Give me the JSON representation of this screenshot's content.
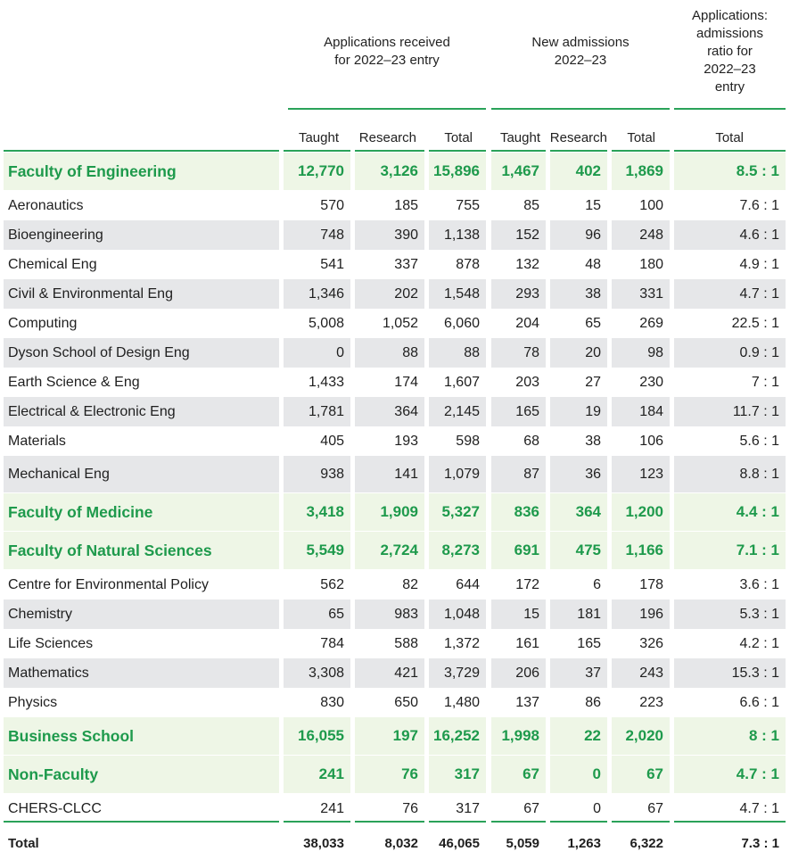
{
  "header": {
    "group_applications": "Applications received\nfor 2022–23 entry",
    "group_admissions": "New admissions\n2022–23",
    "group_ratio": "Applications:\nadmissions\nratio for\n2022–23\nentry",
    "col_taught": "Taught",
    "col_research": "Research",
    "col_total": "Total"
  },
  "rows": [
    {
      "name": "Faculty of Engineering",
      "type": "faculty",
      "a_t": "12,770",
      "a_r": "3,126",
      "a_tot": "15,896",
      "n_t": "1,467",
      "n_r": "402",
      "n_tot": "1,869",
      "ratio": "8.5 : 1"
    },
    {
      "name": "Aeronautics",
      "type": "white",
      "a_t": "570",
      "a_r": "185",
      "a_tot": "755",
      "n_t": "85",
      "n_r": "15",
      "n_tot": "100",
      "ratio": "7.6 : 1"
    },
    {
      "name": "Bioengineering",
      "type": "gray",
      "a_t": "748",
      "a_r": "390",
      "a_tot": "1,138",
      "n_t": "152",
      "n_r": "96",
      "n_tot": "248",
      "ratio": "4.6 : 1"
    },
    {
      "name": "Chemical Eng",
      "type": "white",
      "a_t": "541",
      "a_r": "337",
      "a_tot": "878",
      "n_t": "132",
      "n_r": "48",
      "n_tot": "180",
      "ratio": "4.9 : 1"
    },
    {
      "name": "Civil & Environmental Eng",
      "type": "gray",
      "a_t": "1,346",
      "a_r": "202",
      "a_tot": "1,548",
      "n_t": "293",
      "n_r": "38",
      "n_tot": "331",
      "ratio": "4.7 : 1"
    },
    {
      "name": "Computing",
      "type": "white",
      "a_t": "5,008",
      "a_r": "1,052",
      "a_tot": "6,060",
      "n_t": "204",
      "n_r": "65",
      "n_tot": "269",
      "ratio": "22.5 : 1"
    },
    {
      "name": "Dyson School of Design Eng",
      "type": "gray",
      "a_t": "0",
      "a_r": "88",
      "a_tot": "88",
      "n_t": "78",
      "n_r": "20",
      "n_tot": "98",
      "ratio": "0.9 : 1"
    },
    {
      "name": "Earth Science & Eng",
      "type": "white",
      "a_t": "1,433",
      "a_r": "174",
      "a_tot": "1,607",
      "n_t": "203",
      "n_r": "27",
      "n_tot": "230",
      "ratio": "7 : 1"
    },
    {
      "name": "Electrical & Electronic Eng",
      "type": "gray",
      "a_t": "1,781",
      "a_r": "364",
      "a_tot": "2,145",
      "n_t": "165",
      "n_r": "19",
      "n_tot": "184",
      "ratio": "11.7 : 1"
    },
    {
      "name": "Materials",
      "type": "white",
      "a_t": "405",
      "a_r": "193",
      "a_tot": "598",
      "n_t": "68",
      "n_r": "38",
      "n_tot": "106",
      "ratio": "5.6 : 1"
    },
    {
      "name": "Mechanical Eng",
      "type": "gray",
      "a_t": "938",
      "a_r": "141",
      "a_tot": "1,079",
      "n_t": "87",
      "n_r": "36",
      "n_tot": "123",
      "ratio": "8.8 : 1"
    },
    {
      "name": "Faculty of Medicine",
      "type": "faculty",
      "a_t": "3,418",
      "a_r": "1,909",
      "a_tot": "5,327",
      "n_t": "836",
      "n_r": "364",
      "n_tot": "1,200",
      "ratio": "4.4 : 1"
    },
    {
      "name": "Faculty of Natural Sciences",
      "type": "faculty",
      "a_t": "5,549",
      "a_r": "2,724",
      "a_tot": "8,273",
      "n_t": "691",
      "n_r": "475",
      "n_tot": "1,166",
      "ratio": "7.1 : 1"
    },
    {
      "name": "Centre for Environmental Policy",
      "type": "white",
      "a_t": "562",
      "a_r": "82",
      "a_tot": "644",
      "n_t": "172",
      "n_r": "6",
      "n_tot": "178",
      "ratio": "3.6 : 1"
    },
    {
      "name": "Chemistry",
      "type": "gray",
      "a_t": "65",
      "a_r": "983",
      "a_tot": "1,048",
      "n_t": "15",
      "n_r": "181",
      "n_tot": "196",
      "ratio": "5.3 : 1"
    },
    {
      "name": "Life Sciences",
      "type": "white",
      "a_t": "784",
      "a_r": "588",
      "a_tot": "1,372",
      "n_t": "161",
      "n_r": "165",
      "n_tot": "326",
      "ratio": "4.2 : 1"
    },
    {
      "name": "Mathematics",
      "type": "gray",
      "a_t": "3,308",
      "a_r": "421",
      "a_tot": "3,729",
      "n_t": "206",
      "n_r": "37",
      "n_tot": "243",
      "ratio": "15.3 : 1"
    },
    {
      "name": "Physics",
      "type": "white",
      "a_t": "830",
      "a_r": "650",
      "a_tot": "1,480",
      "n_t": "137",
      "n_r": "86",
      "n_tot": "223",
      "ratio": "6.6 : 1"
    },
    {
      "name": "Business School",
      "type": "faculty",
      "a_t": "16,055",
      "a_r": "197",
      "a_tot": "16,252",
      "n_t": "1,998",
      "n_r": "22",
      "n_tot": "2,020",
      "ratio": "8 : 1"
    },
    {
      "name": "Non-Faculty",
      "type": "faculty",
      "a_t": "241",
      "a_r": "76",
      "a_tot": "317",
      "n_t": "67",
      "n_r": "0",
      "n_tot": "67",
      "ratio": "4.7 : 1"
    },
    {
      "name": "CHERS-CLCC",
      "type": "white",
      "a_t": "241",
      "a_r": "76",
      "a_tot": "317",
      "n_t": "67",
      "n_r": "0",
      "n_tot": "67",
      "ratio": "4.7 : 1"
    },
    {
      "name": "Total",
      "type": "total",
      "a_t": "38,033",
      "a_r": "8,032",
      "a_tot": "46,065",
      "n_t": "5,059",
      "n_r": "1,263",
      "n_tot": "6,322",
      "ratio": "7.3 : 1"
    }
  ],
  "colors": {
    "accent_green": "#1e9a4c",
    "rule_green": "#2aa259",
    "gray_row": "#e6e7e9",
    "faculty_row": "#eef6e6"
  }
}
